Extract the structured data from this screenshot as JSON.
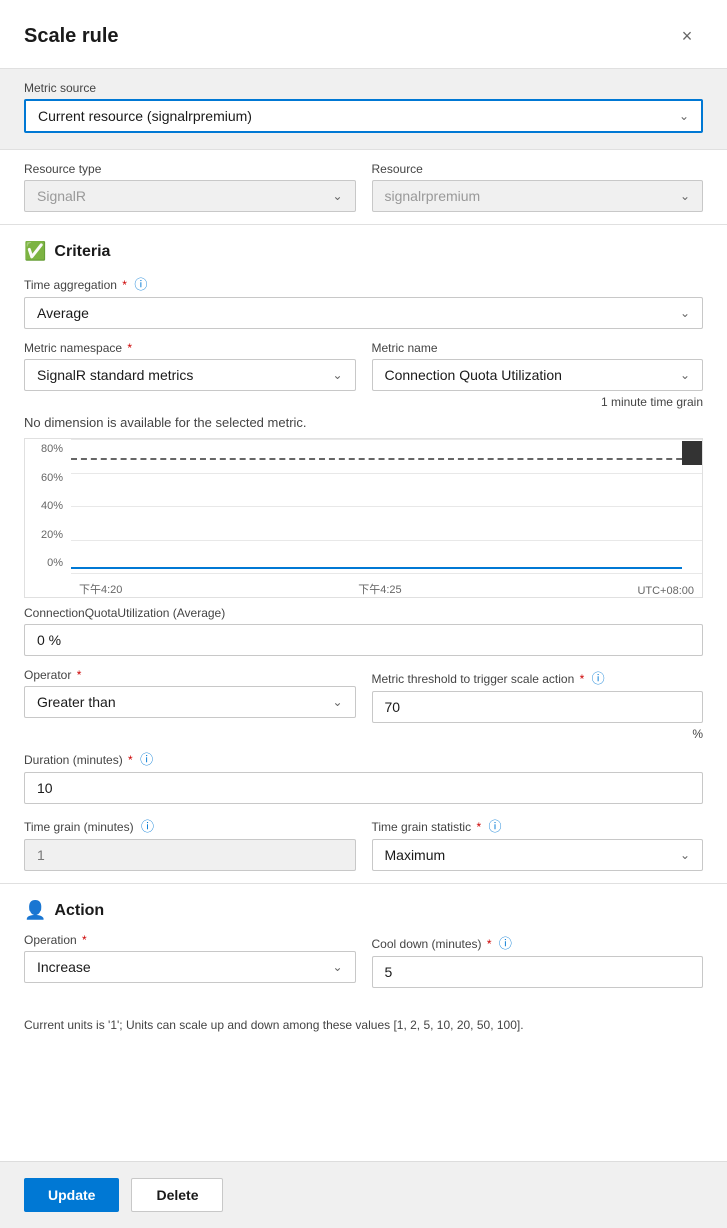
{
  "header": {
    "title": "Scale rule",
    "close_label": "×"
  },
  "metric_source": {
    "label": "Metric source",
    "value": "Current resource (signalrpremium)",
    "options": [
      "Current resource (signalrpremium)"
    ]
  },
  "resource_type": {
    "label": "Resource type",
    "value": "SignalR"
  },
  "resource": {
    "label": "Resource",
    "value": "signalrpremium"
  },
  "criteria": {
    "heading": "Criteria",
    "time_aggregation": {
      "label": "Time aggregation",
      "value": "Average"
    },
    "metric_namespace": {
      "label": "Metric namespace",
      "value": "SignalR standard metrics"
    },
    "metric_name": {
      "label": "Metric name",
      "value": "Connection Quota Utilization"
    },
    "grain_note": "1 minute time grain",
    "dimension_note": "No dimension is available for the selected metric.",
    "chart": {
      "y_labels": [
        "80%",
        "60%",
        "40%",
        "20%",
        "0%"
      ],
      "x_labels": [
        "下午4:20",
        "下午4:25",
        "UTC+08:00"
      ]
    },
    "connection_quota_label": "ConnectionQuotaUtilization (Average)",
    "connection_quota_value": "0 %",
    "operator": {
      "label": "Operator",
      "value": "Greater than"
    },
    "metric_threshold": {
      "label": "Metric threshold to trigger scale action",
      "value": "70",
      "unit": "%"
    },
    "duration": {
      "label": "Duration (minutes)",
      "value": "10"
    },
    "time_grain_minutes": {
      "label": "Time grain (minutes)",
      "value": "1"
    },
    "time_grain_statistic": {
      "label": "Time grain statistic",
      "value": "Maximum"
    }
  },
  "action": {
    "heading": "Action",
    "operation": {
      "label": "Operation",
      "value": "Increase"
    },
    "cool_down": {
      "label": "Cool down (minutes)",
      "value": "5"
    },
    "note": "Current units is '1'; Units can scale up and down among these values [1, 2, 5, 10, 20, 50, 100]."
  },
  "buttons": {
    "update": "Update",
    "delete": "Delete"
  }
}
